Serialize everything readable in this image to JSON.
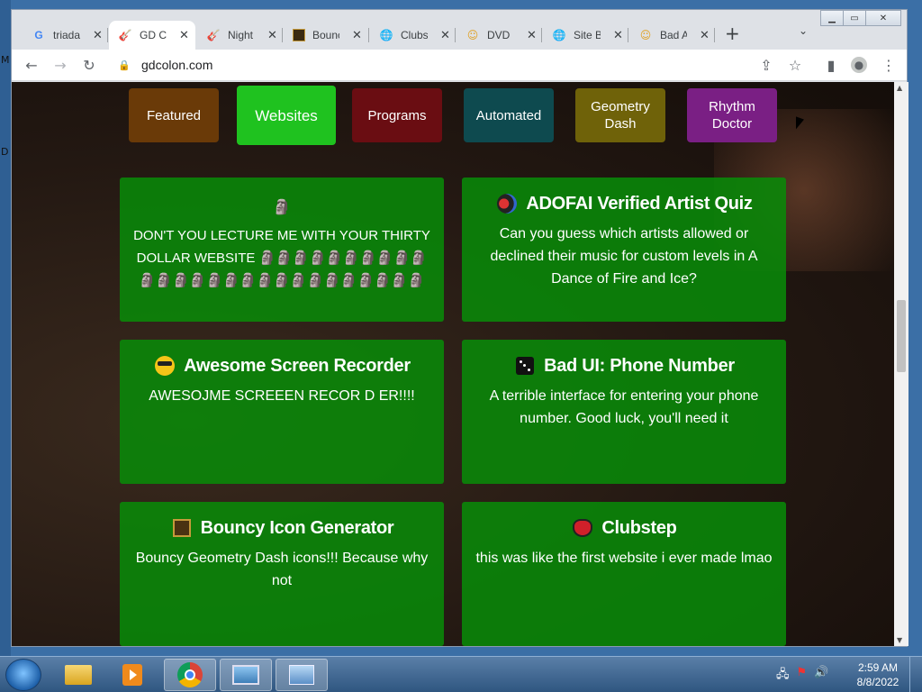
{
  "desktop": {
    "left_letters": [
      "M",
      "D"
    ]
  },
  "browser": {
    "tabs": [
      {
        "title": "triada",
        "icon": "google-icon"
      },
      {
        "title": "GD Co",
        "icon": "guitar-icon"
      },
      {
        "title": "Night",
        "icon": "guitar-icon"
      },
      {
        "title": "Bounc",
        "icon": "gd-cube-icon"
      },
      {
        "title": "Clubs",
        "icon": "globe-icon"
      },
      {
        "title": "DVD",
        "icon": "face-icon"
      },
      {
        "title": "Site B",
        "icon": "globe-icon"
      },
      {
        "title": "Bad A",
        "icon": "face-icon"
      }
    ],
    "new_tab_label": "+",
    "url": "gdcolon.com",
    "colors": {
      "tabstrip": "#dee1e6",
      "toolbar": "#ffffff"
    }
  },
  "page": {
    "categories": [
      {
        "label": "Featured",
        "color": "#6a3a08"
      },
      {
        "label": "Websites",
        "color": "#1fc21f"
      },
      {
        "label": "Programs",
        "color": "#6a0d12"
      },
      {
        "label": "Automated",
        "color": "#0e4a4f"
      },
      {
        "label": "Geometry Dash",
        "color": "#6f6209"
      },
      {
        "label": "Rhythm Doctor",
        "color": "#7a1f84"
      }
    ],
    "cards": [
      {
        "title": "",
        "description": "DON'T YOU LECTURE ME WITH YOUR THIRTY DOLLAR WEBSITE 🗿🗿🗿🗿🗿🗿🗿🗿🗿🗿🗿🗿🗿🗿🗿🗿🗿🗿🗿🗿🗿🗿🗿🗿🗿🗿🗿🗿🗿🗿🗿🗿🗿🗿🗿🗿",
        "icon": "moai-icon"
      },
      {
        "title": "ADOFAI Verified Artist Quiz",
        "description": "Can you guess which artists allowed or declined their music for custom levels in A Dance of Fire and Ice?",
        "icon": "planets-icon"
      },
      {
        "title": "Awesome Screen Recorder",
        "description": "AWESOJME SCREEEN RECOR D ER!!!!",
        "icon": "sunglasses-face-icon"
      },
      {
        "title": "Bad UI: Phone Number",
        "description": "A terrible interface for entering your phone number. Good luck, you'll need it",
        "icon": "dice-icon"
      },
      {
        "title": "Bouncy Icon Generator",
        "description": "Bouncy Geometry Dash icons!!! Because why not",
        "icon": "gd-cube-icon"
      },
      {
        "title": "Clubstep",
        "description": "this was like the first website i ever made lmao",
        "icon": "demon-face-icon"
      }
    ],
    "card_color": "#088c08"
  },
  "taskbar": {
    "apps": [
      "explorer-icon",
      "media-player-icon",
      "chrome-icon",
      "photo-viewer-icon",
      "control-panel-icon"
    ],
    "clock_time": "2:59 AM",
    "clock_date": "8/8/2022"
  }
}
